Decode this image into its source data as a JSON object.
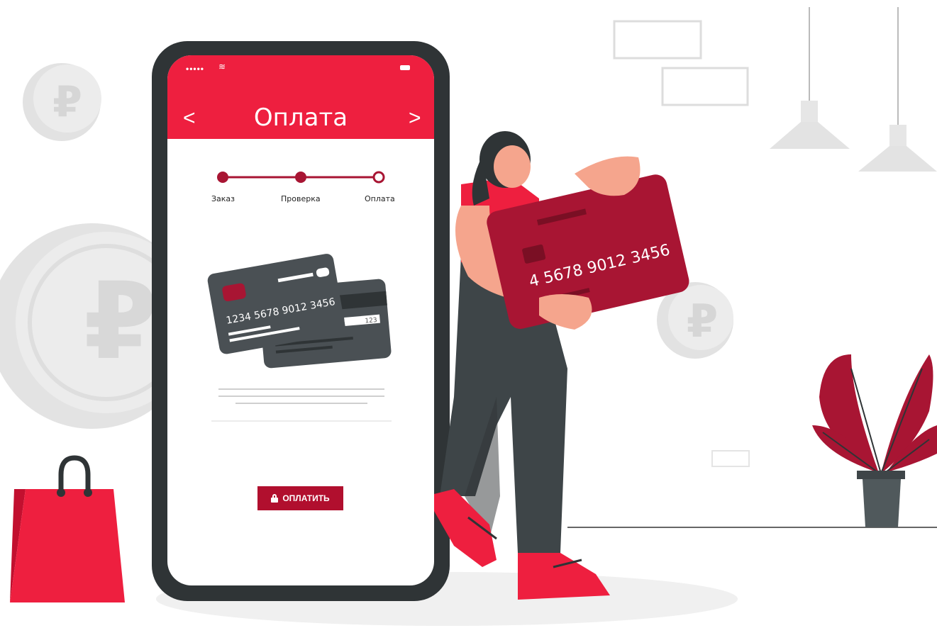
{
  "colors": {
    "accent": "#ee1f3f",
    "accent_dark": "#b10f2e",
    "phone_frame": "#2f3436",
    "card_dark": "#4a5054",
    "card_red": "#a81533",
    "coin_grey": "#e6e6e6"
  },
  "phone": {
    "status_dots": "•••••",
    "title": "Оплата",
    "back_icon": "chevron-left-icon",
    "forward_icon": "chevron-right-icon",
    "back_glyph": "<",
    "forward_glyph": ">",
    "steps": [
      {
        "label": "Заказ",
        "state": "done"
      },
      {
        "label": "Проверка",
        "state": "done"
      },
      {
        "label": "Оплата",
        "state": "current"
      }
    ],
    "card_front_number": "1234 5678 9012 3456",
    "card_back_cvv": "123",
    "pay_button": "ОПЛАТИТЬ"
  },
  "illustration": {
    "big_card_number": "4 5678 9012 3456",
    "currency_symbol": "₽"
  }
}
